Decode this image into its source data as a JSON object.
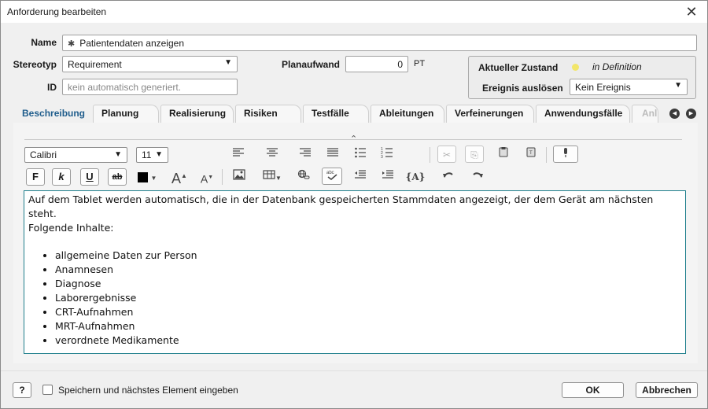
{
  "window": {
    "title": "Anforderung bearbeiten"
  },
  "form": {
    "name_label": "Name",
    "name_value": "Patientendaten anzeigen",
    "stereotype_label": "Stereotyp",
    "stereotype_value": "Requirement",
    "id_label": "ID",
    "id_placeholder": "kein automatisch generiert.",
    "plan_effort_label": "Planaufwand",
    "plan_effort_value": "0",
    "plan_effort_unit": "PT"
  },
  "state": {
    "current_state_label": "Aktueller Zustand",
    "current_state_value": "in Definition",
    "current_state_color": "#f2e66a",
    "trigger_label": "Ereignis auslösen",
    "trigger_value": "Kein Ereignis"
  },
  "tabs": [
    {
      "label": "Beschreibung",
      "active": true
    },
    {
      "label": "Planung"
    },
    {
      "label": "Realisierung"
    },
    {
      "label": "Risiken"
    },
    {
      "label": "Testfälle"
    },
    {
      "label": "Ableitungen"
    },
    {
      "label": "Verfeinerungen"
    },
    {
      "label": "Anwendungsfälle"
    },
    {
      "label": "Anl"
    }
  ],
  "toolbar": {
    "font_family": "Calibri",
    "font_size": "11",
    "bold_label": "F",
    "italic_label": "k",
    "underline_label": "U",
    "strike_label": "ab",
    "grow_font_label": "A",
    "shrink_font_label": "A",
    "variable_label": "{A}",
    "text_color": "#000000",
    "icons": [
      "align-left-icon",
      "align-center-icon",
      "align-right-icon",
      "align-justify-icon",
      "bullet-list-icon",
      "numbered-list-icon",
      "cut-icon",
      "copy-icon",
      "paste-icon",
      "paste-text-icon",
      "microphone-icon",
      "image-icon",
      "table-icon",
      "link-icon",
      "spellcheck-icon",
      "outdent-icon",
      "indent-icon",
      "undo-icon",
      "redo-icon"
    ]
  },
  "description": {
    "line1": "Auf dem Tablet werden automatisch, die in der Datenbank gespeicherten Stammdaten angezeigt, der dem Gerät am nächsten steht.",
    "line2": "Folgende Inhalte:",
    "items": [
      "allgemeine Daten zur Person",
      "Anamnesen",
      "Diagnose",
      "Laborergebnisse",
      "CRT-Aufnahmen",
      "MRT-Aufnahmen",
      "verordnete Medikamente"
    ]
  },
  "footer": {
    "help_label": "?",
    "save_next_label": "Speichern und nächstes Element eingeben",
    "ok_label": "OK",
    "cancel_label": "Abbrechen"
  }
}
